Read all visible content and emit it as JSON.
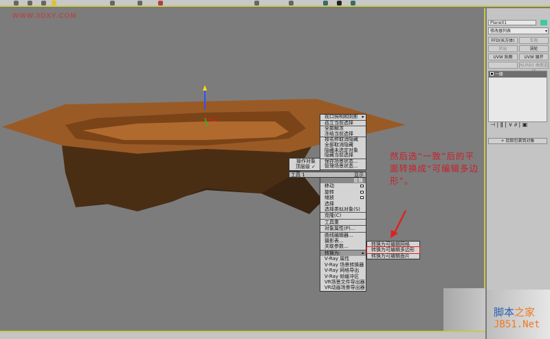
{
  "watermark": "WWW.3DXY.COM",
  "menu_top": [
    "视口照明和阴影",
    "孤立当前选择",
    "全部解冻",
    "冻结当前选择",
    "按名称取消隐藏",
    "全部取消隐藏",
    "隐藏未选定对象",
    "隐藏当前选择",
    "保存场景状态...",
    "管理场景状态..."
  ],
  "menu_left": {
    "items": [
      "操作对象",
      "顶层级 ✓"
    ],
    "tools_label": "工具 1",
    "display_label": "显示",
    "transform_label": "变换"
  },
  "menu_bottom": [
    "移动",
    "旋转",
    "缩放",
    "选择",
    "选择类似对象(S)",
    "克隆(C)",
    "工具重",
    "对象属性(P)...",
    "曲线编辑器...",
    "摄影表...",
    "关联参数...",
    "转换为:",
    "V-Ray 属性",
    "V-Ray 场景转换器",
    "V-Ray 网格导出",
    "V-Ray 帧缓冲区",
    "VR场景文件导出器",
    "VR动画场景导出器"
  ],
  "submenu": [
    "转换为可编辑网格",
    "转换为可编辑多边形",
    "转换为可编辑面片"
  ],
  "note": "然后选“一致”后的平面转换成“可编辑多边形”。",
  "panel": {
    "object_name": "Plane01",
    "modifier_list": "修改器列表",
    "buttons": [
      "FFD(长方体)",
      "车削",
      "挤出",
      "涡轮",
      "UVW 贴图",
      "UVW 展开",
      "",
      "NURBS 曲面选择"
    ],
    "stack_item": "一般",
    "rollout": "拾取包裹到对象"
  },
  "site": {
    "line1_a": "脚本",
    "line1_b": "之家",
    "line2": "JB51.Net"
  }
}
